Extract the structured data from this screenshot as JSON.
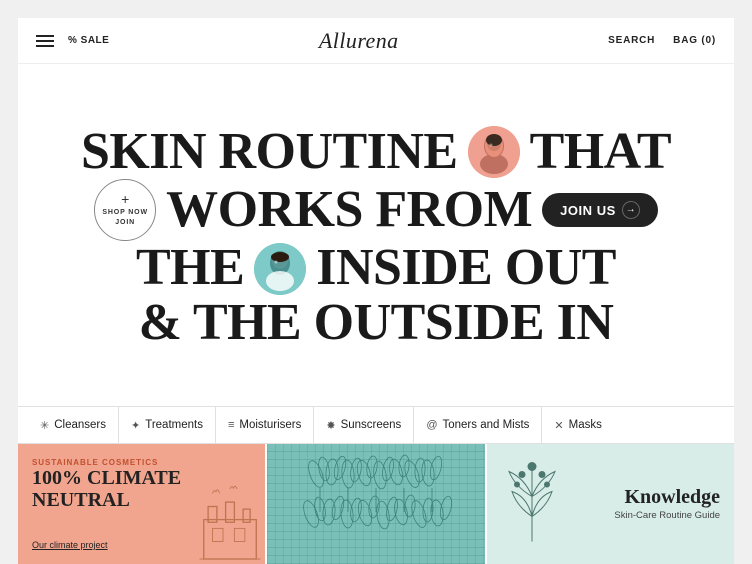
{
  "header": {
    "sale_label": "% SALE",
    "logo": "Allurena",
    "search_label": "SEARCH",
    "bag_label": "BAG (0)"
  },
  "hero": {
    "line1": "SKIN ROUTINE",
    "line1_suffix": "THAT",
    "line2": "WORKS FROM",
    "line2_cta": "JOIN US",
    "line3": "THE",
    "line3_suffix": "INSIDE OUT",
    "line4": "& THE OUTSIDE IN",
    "shop_now_line1": "SHOP NOW",
    "shop_now_line2": "JOIN",
    "avatar1_bg": "#f0a090",
    "avatar2_bg": "#7ecac8"
  },
  "categories": [
    {
      "icon": "✳",
      "label": "Cleansers"
    },
    {
      "icon": "✦",
      "label": "Treatments"
    },
    {
      "icon": "≡",
      "label": "Moisturisers"
    },
    {
      "icon": "✸",
      "label": "Sunscreens"
    },
    {
      "icon": "@",
      "label": "Toners and Mists"
    },
    {
      "icon": "✕",
      "label": "Masks"
    }
  ],
  "cards": [
    {
      "type": "salmon",
      "label": "SUSTAINABLE COSMETICS",
      "title": "100% CLIMATE NEUTRAL",
      "link": "Our climate project"
    },
    {
      "type": "dark"
    },
    {
      "type": "light",
      "title": "Knowledge",
      "subtitle": "Skin-Care Routine Guide"
    }
  ]
}
